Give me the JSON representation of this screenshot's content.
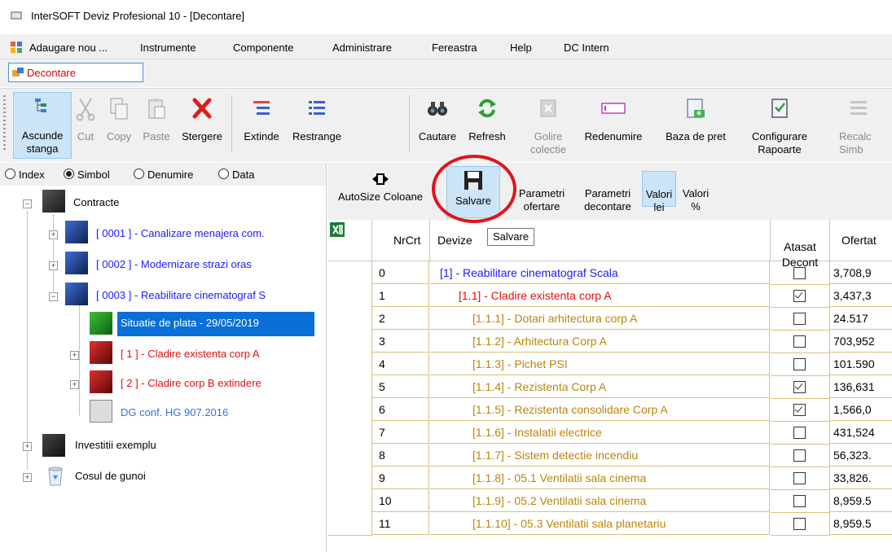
{
  "window": {
    "title": "InterSOFT Deviz Profesional 10 - [Decontare]"
  },
  "menu": [
    "Adaugare nou ...",
    "Instrumente",
    "Componente",
    "Administrare",
    "Fereastra",
    "Help",
    "DC Intern"
  ],
  "doc_tab": "Decontare",
  "toolbar": [
    {
      "label": "Ascunde\nstanga",
      "icon": "hide-left-icon",
      "enabled": true
    },
    {
      "label": "Cut",
      "icon": "scissors-icon",
      "enabled": false
    },
    {
      "label": "Copy",
      "icon": "copy-icon",
      "enabled": false
    },
    {
      "label": "Paste",
      "icon": "paste-icon",
      "enabled": false
    },
    {
      "label": "Stergere",
      "icon": "delete-x-icon",
      "enabled": true
    },
    {
      "label": "Extinde",
      "icon": "expand-list-icon",
      "enabled": true
    },
    {
      "label": "Restrange",
      "icon": "collapse-list-icon",
      "enabled": true
    },
    {
      "label": "Cautare",
      "icon": "binoculars-icon",
      "enabled": true
    },
    {
      "label": "Refresh",
      "icon": "refresh-icon",
      "enabled": true
    },
    {
      "label": "Golire\ncolectie",
      "icon": "clear-collection-icon",
      "enabled": false
    },
    {
      "label": "Redenumire",
      "icon": "rename-icon",
      "enabled": true
    },
    {
      "label": "Baza de pret",
      "icon": "price-base-icon",
      "enabled": true
    },
    {
      "label": "Configurare\nRapoarte",
      "icon": "report-config-icon",
      "enabled": true
    },
    {
      "label": "Recalc\nSimb",
      "icon": "recalc-icon",
      "enabled": false
    }
  ],
  "radios": [
    {
      "label": "Index",
      "checked": false
    },
    {
      "label": "Simbol",
      "checked": true
    },
    {
      "label": "Denumire",
      "checked": false
    },
    {
      "label": "Data",
      "checked": false
    }
  ],
  "tree": [
    {
      "label": "Contracte",
      "color": "#000000",
      "selected": false
    },
    {
      "label": "[ 0001 ] - Canalizare menajera com.",
      "color": "#1a1aff",
      "selected": false
    },
    {
      "label": "[ 0002 ] - Modernizare strazi oras",
      "color": "#1a1aff",
      "selected": false
    },
    {
      "label": "[ 0003 ] - Reabilitare cinematograf S",
      "color": "#1a1aff",
      "selected": false
    },
    {
      "label": "Situatie de plata - 29/05/2019",
      "color": "#ffffff",
      "selected": true
    },
    {
      "label": "[ 1 ] - Cladire existenta corp A",
      "color": "#e01010",
      "selected": false
    },
    {
      "label": "[ 2 ] - Cladire corp B extindere",
      "color": "#e01010",
      "selected": false
    },
    {
      "label": "DG conf. HG 907.2016",
      "color": "#3a6fd8",
      "selected": false
    },
    {
      "label": "Investitii exemplu",
      "color": "#000000",
      "selected": false
    },
    {
      "label": "Cosul de gunoi",
      "color": "#000000",
      "selected": false
    }
  ],
  "right_toolbar": {
    "autosize": "AutoSize Coloane",
    "salvare": "Salvare",
    "param_ofertare": "Parametri\nofertare",
    "param_decontare": "Parametri\ndecontare",
    "valori_lei": "Valori\nlei",
    "valori_pct": "Valori\n%"
  },
  "tooltip": "Salvare",
  "grid": {
    "headers": {
      "nrcrt": "NrCrt",
      "devize": "Devize",
      "atasat": "Atasat\nDecont",
      "ofertat": "Ofertat"
    },
    "rows": [
      {
        "nr": "0",
        "name": "[1] - Reabilitare cinematograf Scala",
        "checked": false,
        "ofertat": "3,708,9",
        "color": "#1a1aff",
        "indent": 0
      },
      {
        "nr": "1",
        "name": "[1.1] - Cladire existenta corp A",
        "checked": true,
        "ofertat": "3,437,3",
        "color": "#e01010",
        "indent": 1
      },
      {
        "nr": "2",
        "name": "[1.1.1] - Dotari arhitectura corp A",
        "checked": false,
        "ofertat": "24.517",
        "color": "#b8860b",
        "indent": 2
      },
      {
        "nr": "3",
        "name": "[1.1.2] - Arhitectura Corp A",
        "checked": false,
        "ofertat": "703,952",
        "color": "#b8860b",
        "indent": 2
      },
      {
        "nr": "4",
        "name": "[1.1.3] - Pichet PSI",
        "checked": false,
        "ofertat": "101.590",
        "color": "#b8860b",
        "indent": 2
      },
      {
        "nr": "5",
        "name": "[1.1.4] - Rezistenta Corp A",
        "checked": true,
        "ofertat": "136,631",
        "color": "#b8860b",
        "indent": 2
      },
      {
        "nr": "6",
        "name": "[1.1.5] - Rezistenta consolidare Corp A",
        "checked": true,
        "ofertat": "1,566,0",
        "color": "#b8860b",
        "indent": 2
      },
      {
        "nr": "7",
        "name": "[1.1.6] - Instalatii electrice",
        "checked": false,
        "ofertat": "431,524",
        "color": "#b8860b",
        "indent": 2
      },
      {
        "nr": "8",
        "name": "[1.1.7] - Sistem detectie incendiu",
        "checked": false,
        "ofertat": "56,323.",
        "color": "#b8860b",
        "indent": 2
      },
      {
        "nr": "9",
        "name": "[1.1.8] - 05.1 Ventilatii sala cinema",
        "checked": false,
        "ofertat": "33,826.",
        "color": "#b8860b",
        "indent": 2
      },
      {
        "nr": "10",
        "name": "[1.1.9] - 05.2 Ventilatii sala cinema",
        "checked": false,
        "ofertat": "8,959.5",
        "color": "#b8860b",
        "indent": 2
      },
      {
        "nr": "11",
        "name": "[1.1.10] - 05.3 Ventilatii sala planetariu",
        "checked": false,
        "ofertat": "8,959.5",
        "color": "#b8860b",
        "indent": 2
      }
    ]
  }
}
